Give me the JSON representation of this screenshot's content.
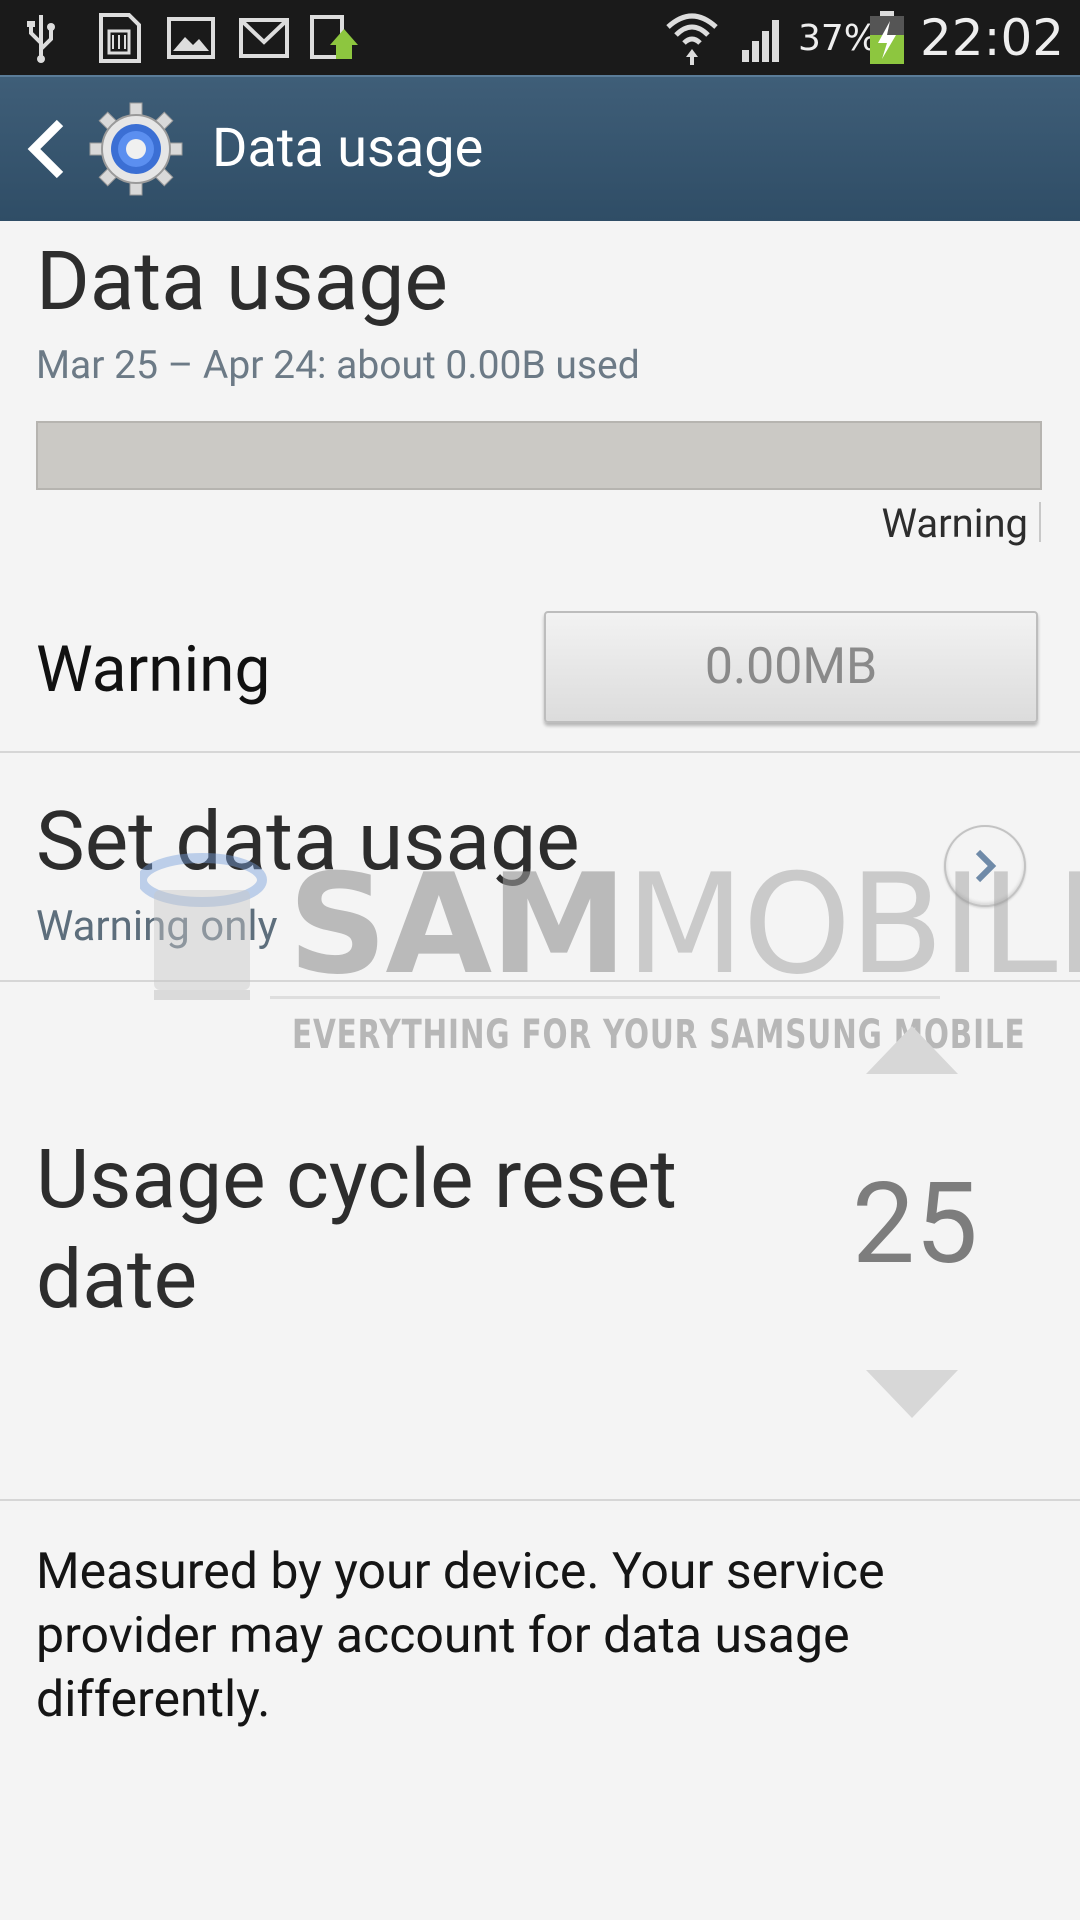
{
  "status_bar": {
    "icons": [
      "usb-icon",
      "sd-card-icon",
      "gallery-icon",
      "gmail-icon",
      "upload-icon",
      "wifi-icon",
      "signal-icon",
      "battery-charging-icon"
    ],
    "battery": "37%",
    "time": "22:02"
  },
  "action_bar": {
    "back_icon": "back-arrow-icon",
    "app_icon": "settings-gear-icon",
    "title": "Data usage"
  },
  "summary": {
    "title": "Data usage",
    "range": "Mar 25 – Apr 24: about 0.00B used",
    "usage_fraction": 0.0,
    "warning_marker_label": "Warning"
  },
  "warning_row": {
    "label": "Warning",
    "value": "0.00MB"
  },
  "set_data_usage": {
    "title": "Set data usage",
    "subtitle": "Warning only",
    "chevron_icon": "chevron-right-icon"
  },
  "cycle": {
    "label": "Usage cycle reset date",
    "value": "25",
    "up_icon": "arrow-up-icon",
    "down_icon": "arrow-down-icon"
  },
  "footnote": "Measured by your device. Your service provider may account for data usage differently.",
  "watermark": {
    "brand_bold": "SAM",
    "brand_light": "MOBILE",
    "tagline": "EVERYTHING FOR YOUR SAMSUNG MOBILE"
  },
  "colors": {
    "action_bar": "#3a5a74",
    "accent_text": "#6c7a86",
    "background": "#f4f4f4"
  }
}
